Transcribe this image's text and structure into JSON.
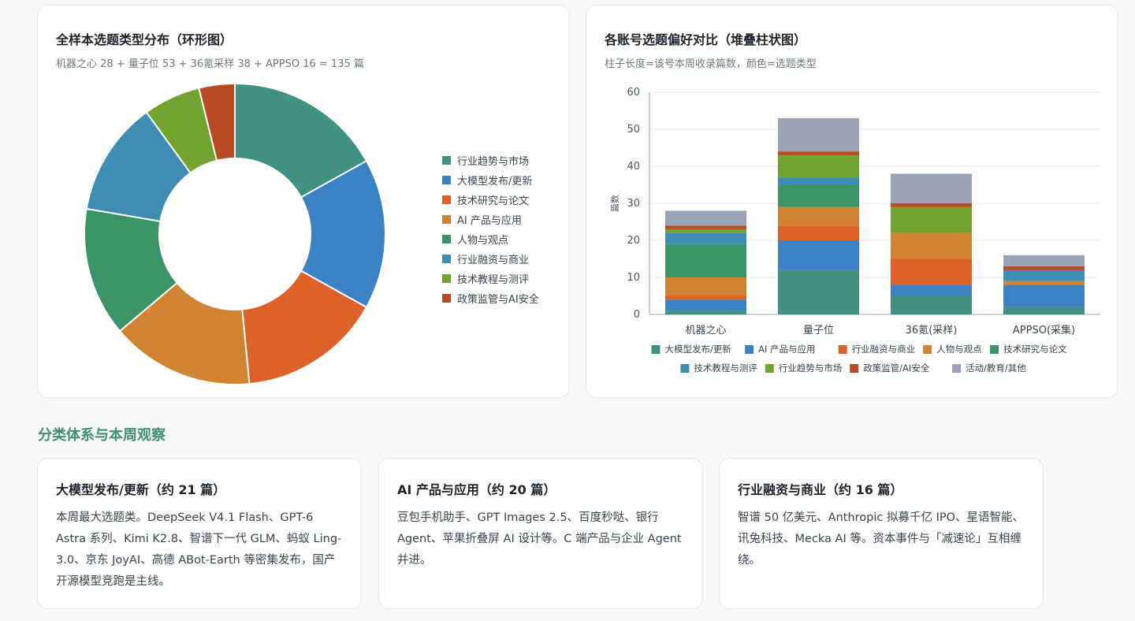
{
  "donut_card": {
    "title": "全样本选题类型分布（环形图）",
    "subtitle": "机器之心 28 + 量子位 53 + 36氪采样 38 + APPSO 16 = 135 篇"
  },
  "bar_card": {
    "title": "各账号选题偏好对比（堆叠柱状图）",
    "subtitle": "柱子长度=该号本周收录篇数，颜色=选题类型"
  },
  "section": {
    "title": "分类体系与本周观察"
  },
  "category_cards": [
    {
      "title": "大模型发布/更新（约 21 篇）",
      "body": "本周最大选题类。DeepSeek V4.1 Flash、GPT-6 Astra 系列、Kimi K2.8、智谱下一代 GLM、蚂蚁 Ling-3.0、京东 JoyAI、高德 ABot-Earth 等密集发布，国产开源模型竞跑是主线。"
    },
    {
      "title": "AI 产品与应用（约 20 篇）",
      "body": "豆包手机助手、GPT Images 2.5、百度秒哒、银行 Agent、苹果折叠屏 AI 设计等。C 端产品与企业 Agent 并进。"
    },
    {
      "title": "行业融资与商业（约 16 篇）",
      "body": "智谱 50 亿美元、Anthropic 拟募千亿 IPO、星语智能、讯兔科技、Mecka AI 等。资本事件与「减速论」互相缠绕。"
    }
  ],
  "chart_data": [
    {
      "type": "pie",
      "donut": true,
      "labels": [
        "行业趋势与市场",
        "大模型发布/更新",
        "技术研究与论文",
        "AI 产品与应用",
        "人物与观点",
        "行业融资与商业",
        "技术教程与测评",
        "政策监管与AI安全"
      ],
      "values": [
        22,
        21,
        20,
        20,
        18,
        16,
        8,
        5
      ],
      "colors": [
        "#3f9282",
        "#3a82c4",
        "#dd6229",
        "#d08431",
        "#3b9466",
        "#3e8db3",
        "#72a230",
        "#b84b22"
      ],
      "legend": "right"
    },
    {
      "type": "bar",
      "stacked": true,
      "categories": [
        "机器之心",
        "量子位",
        "36氪(采样)",
        "APPSO(采集)"
      ],
      "ylabel": "篇数",
      "ylim": [
        0,
        60
      ],
      "yticks": [
        0,
        10,
        20,
        30,
        40,
        50,
        60
      ],
      "grid": true,
      "legend": "bottom",
      "series": [
        {
          "name": "大模型发布/更新",
          "color": "#3f9282",
          "values": [
            1,
            12,
            5,
            2
          ]
        },
        {
          "name": "AI 产品与应用",
          "color": "#3a82c4",
          "values": [
            3,
            8,
            3,
            6
          ]
        },
        {
          "name": "行业融资与商业",
          "color": "#dd6229",
          "values": [
            1,
            4,
            7,
            0
          ]
        },
        {
          "name": "人物与观点",
          "color": "#d08431",
          "values": [
            5,
            5,
            7,
            1
          ]
        },
        {
          "name": "技术研究与论文",
          "color": "#3b9466",
          "values": [
            9,
            6,
            0,
            0
          ]
        },
        {
          "name": "技术教程与测评",
          "color": "#3e8db3",
          "values": [
            3,
            2,
            0,
            3
          ]
        },
        {
          "name": "行业趋势与市场",
          "color": "#72a230",
          "values": [
            1,
            6,
            7,
            0
          ]
        },
        {
          "name": "政策监管/AI安全",
          "color": "#b84b22",
          "values": [
            1,
            1,
            1,
            1
          ]
        },
        {
          "name": "活动/教育/其他",
          "color": "#9ba5b7",
          "values": [
            4,
            9,
            8,
            3
          ]
        }
      ]
    }
  ]
}
